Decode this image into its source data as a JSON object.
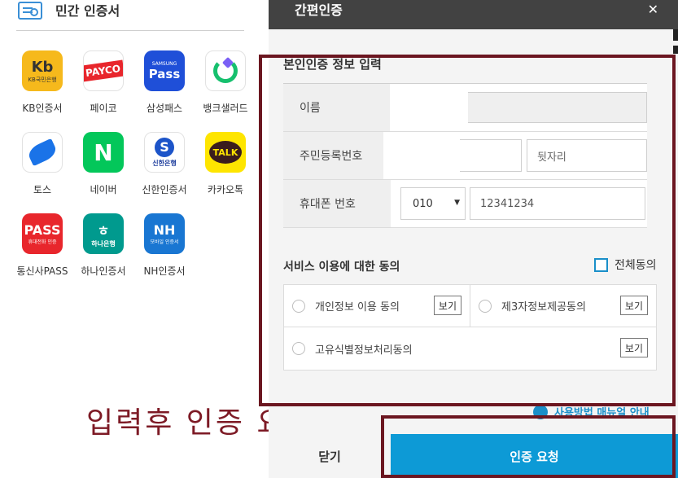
{
  "left": {
    "title": "민간 인증서",
    "apps": [
      {
        "label": "KB인증서",
        "icon": "kb-icon",
        "mark": "Kb",
        "sub": "KB국민은행"
      },
      {
        "label": "페이코",
        "icon": "payco-icon",
        "mark": "PAYCO"
      },
      {
        "label": "삼성패스",
        "icon": "samsung-pass-icon",
        "mark": "Pass",
        "sub": "SAMSUNG"
      },
      {
        "label": "뱅크샐러드",
        "icon": "banksalad-icon"
      },
      {
        "label": "토스",
        "icon": "toss-icon"
      },
      {
        "label": "네이버",
        "icon": "naver-icon",
        "mark": "N"
      },
      {
        "label": "신한인증서",
        "icon": "shinhan-icon",
        "mark": "S",
        "sub": "신한은행"
      },
      {
        "label": "카카오톡",
        "icon": "kakaotalk-icon",
        "mark": "TALK"
      },
      {
        "label": "통신사PASS",
        "icon": "pass-icon",
        "mark": "PASS",
        "sub": "휴대전화 인증"
      },
      {
        "label": "하나인증서",
        "icon": "hana-icon",
        "mark": "하나은행"
      },
      {
        "label": "NH인증서",
        "icon": "nh-icon",
        "mark": "NH",
        "sub": "모바일 인증서"
      }
    ],
    "caption": "입력후 인증 요청"
  },
  "modal": {
    "title": "간편인증",
    "close_glyph": "✕",
    "section_title": "본인인증 정보 입력",
    "fields": {
      "name_label": "이름",
      "rrn_label": "주민등록번호",
      "rrn_back_placeholder": "뒷자리",
      "phone_label": "휴대폰 번호",
      "carrier_selected": "010",
      "phone_value": "12341234"
    },
    "agree": {
      "title": "서비스 이용에 대한 동의",
      "all_label": "전체동의",
      "items": [
        {
          "label": "개인정보 이용 동의",
          "view": "보기"
        },
        {
          "label": "제3자정보제공동의",
          "view": "보기"
        },
        {
          "label": "고유식별정보처리동의",
          "view": "보기"
        }
      ]
    },
    "manual_link": "사용방법 매뉴얼 안내",
    "close_button": "닫기",
    "request_button": "인증 요청"
  }
}
